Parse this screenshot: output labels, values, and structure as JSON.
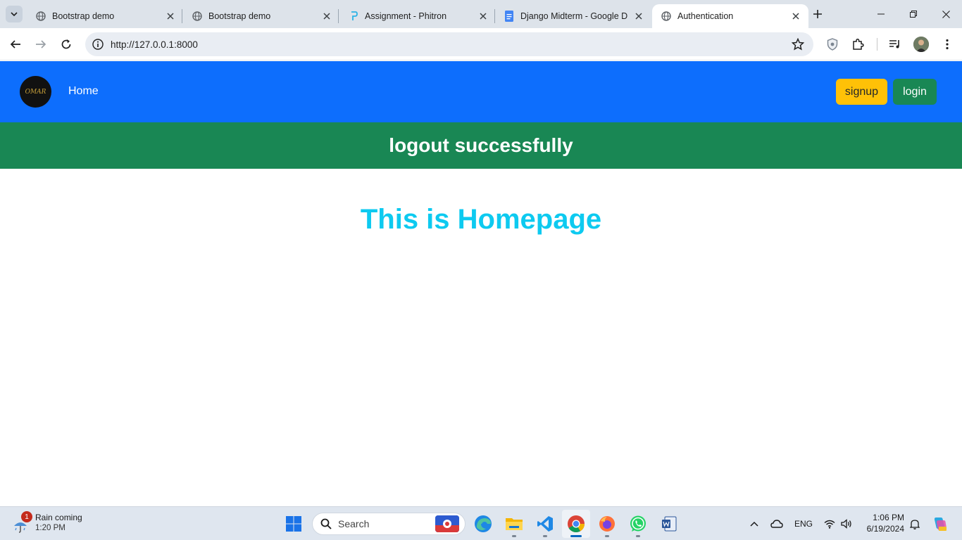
{
  "browser": {
    "tabs": [
      {
        "title": "Bootstrap demo",
        "favicon": "globe-icon",
        "active": false
      },
      {
        "title": "Bootstrap demo",
        "favicon": "globe-icon",
        "active": false
      },
      {
        "title": "Assignment - Phitron",
        "favicon": "phitron-icon",
        "active": false
      },
      {
        "title": "Django Midterm - Google D",
        "favicon": "google-docs-icon",
        "active": false
      },
      {
        "title": "Authentication",
        "favicon": "globe-icon",
        "active": true
      }
    ],
    "url": "http://127.0.0.1:8000"
  },
  "navbar": {
    "brand_text": "OMAR",
    "home_label": "Home",
    "signup_label": "signup",
    "login_label": "login",
    "colors": {
      "navbar": "#0d6efd",
      "signup": "#ffc107",
      "login": "#198754"
    }
  },
  "alert": {
    "message": "logout successfully",
    "color": "#198754"
  },
  "main": {
    "heading": "This is Homepage",
    "heading_color": "#0dcaf0"
  },
  "taskbar": {
    "weather": {
      "title": "Rain coming",
      "time": "1:20 PM",
      "badge": "1"
    },
    "search_placeholder": "Search",
    "apps": [
      "windows-start-icon",
      "edge-icon",
      "file-explorer-icon",
      "vscode-icon",
      "chrome-icon",
      "firefox-icon",
      "whatsapp-icon",
      "word-icon"
    ],
    "language": "ENG",
    "clock": {
      "time": "1:06 PM",
      "date": "6/19/2024"
    }
  }
}
